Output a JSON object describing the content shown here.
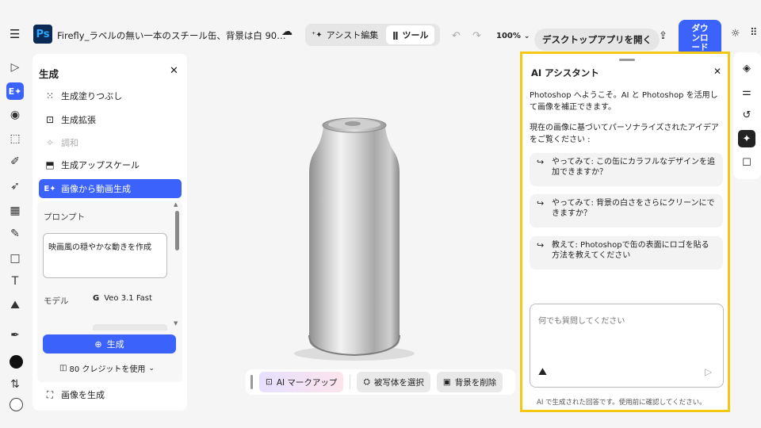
{
  "header": {
    "menu_icon": "hamburger-icon",
    "app_badge": "Ps",
    "doc_title": "Firefly_ラベルの無い一本のスチール缶、背景は白 90…",
    "assist_label": "アシスト編集",
    "tools_label": "ツール",
    "zoom": "100%",
    "desktop_button": "デスクトップアプリを開く",
    "download_line1": "ダウ",
    "download_line2": "ンロ",
    "download_line3": "ード"
  },
  "left_panel": {
    "title": "生成",
    "items": [
      {
        "icon": "generative-fill-icon",
        "label": "生成塗りつぶし",
        "state": "normal"
      },
      {
        "icon": "generative-expand-icon",
        "label": "生成拡張",
        "state": "normal"
      },
      {
        "icon": "harmonize-icon",
        "label": "調和",
        "state": "disabled"
      },
      {
        "icon": "upscale-icon",
        "label": "生成アップスケール",
        "state": "normal"
      },
      {
        "icon": "image-to-video-icon",
        "label": "画像から動画生成",
        "state": "active"
      }
    ],
    "prompt_label": "プロンプト",
    "prompt_value": "映画風の穏やかな動きを作成",
    "model_label": "モデル",
    "model_value": "Veo 3.1 Fast",
    "generate_button": "生成",
    "credits": "80 クレジットを使用",
    "image_gen_label": "画像を生成"
  },
  "canvas": {
    "image_alt": "silver aluminum can on white background"
  },
  "bottom_toolbar": {
    "ai_markup": "AI マークアップ",
    "select_subject": "被写体を選択",
    "remove_bg": "背景を削除"
  },
  "ai_assistant": {
    "title": "AI アシスタント",
    "intro": "Photoshop へようこそ。AI と Photoshop を活用して画像を補正できます。",
    "personalized": "現在の画像に基づいてパーソナライズされたアイデアをご覧ください :",
    "suggestions": [
      "やってみて: この缶にカラフルなデザインを追加できますか？",
      "やってみて: 背景の白さをさらにクリーンにできますか？",
      "教えて: Photoshopで缶の表面にロゴを貼る方法を教えてください"
    ],
    "input_placeholder": "何でも質問してください",
    "disclaimer": "AI で生成された回答です。使用前に確認してください。"
  },
  "colors": {
    "accent": "#3b63fb",
    "highlight_border": "#f5c816"
  }
}
